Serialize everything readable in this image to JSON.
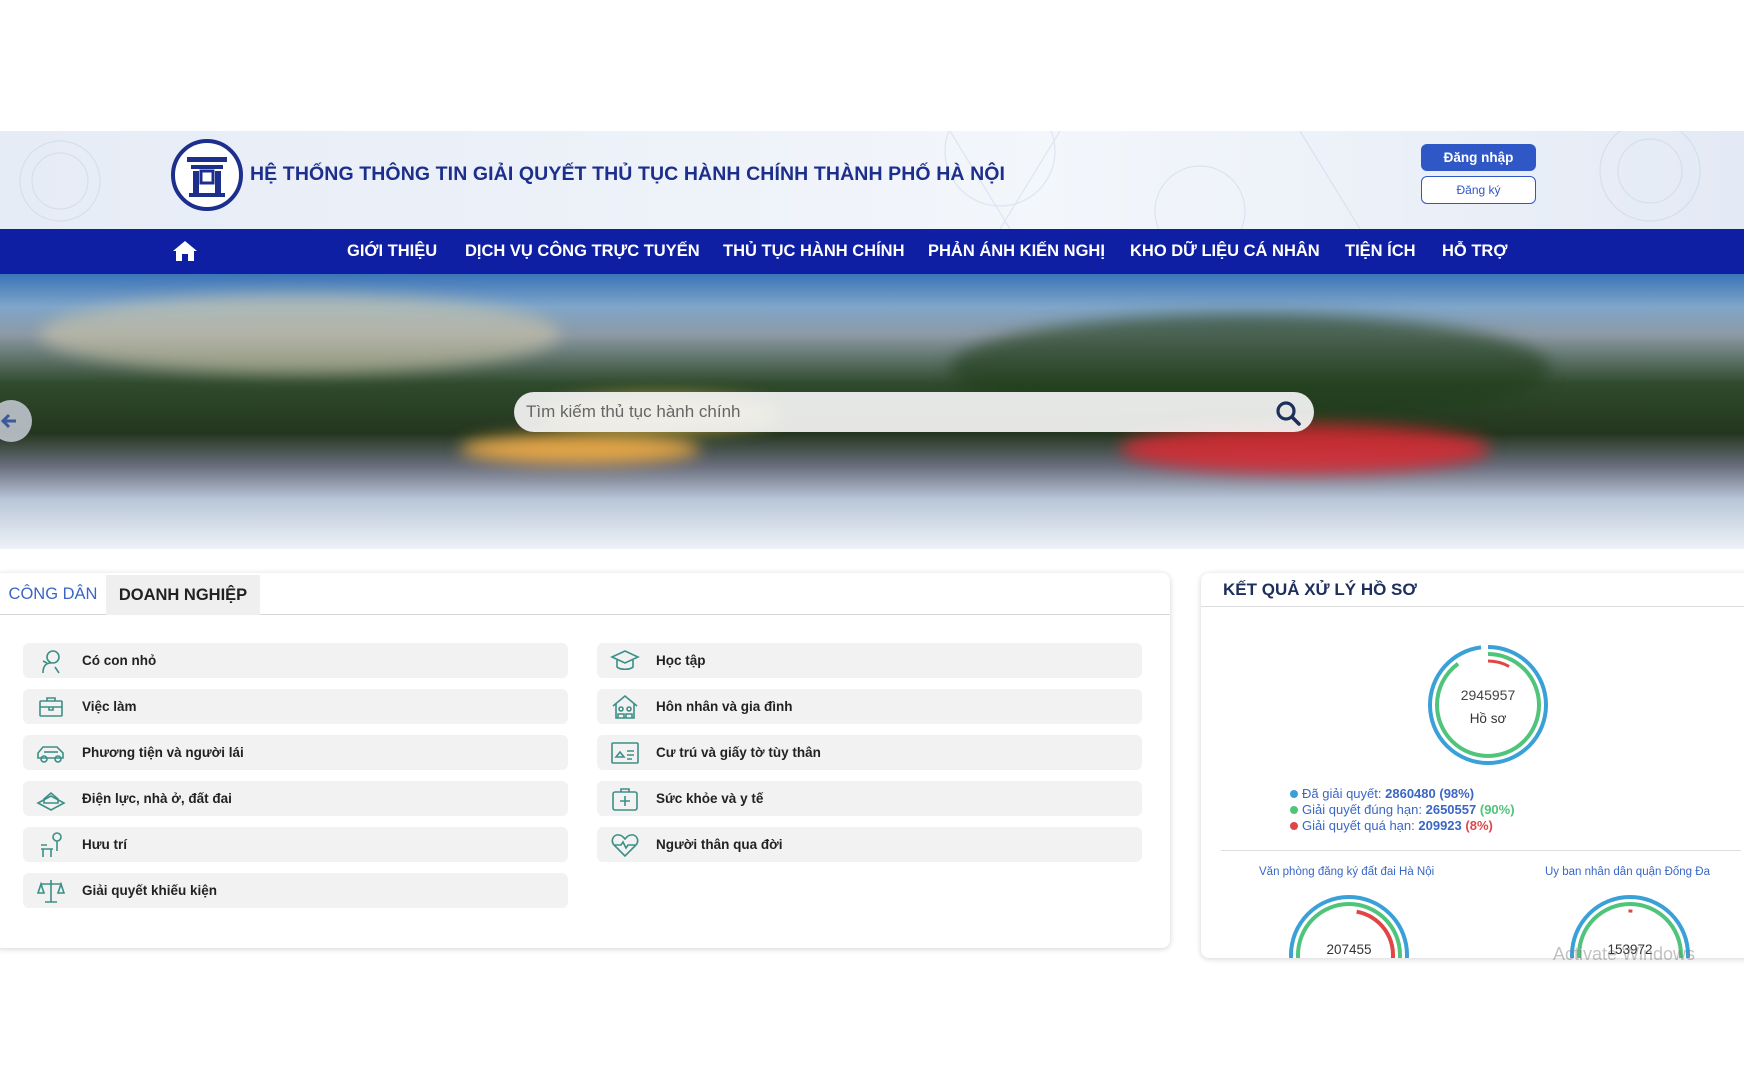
{
  "header": {
    "title": "HỆ THỐNG THÔNG TIN GIẢI QUYẾT THỦ TỤC HÀNH CHÍNH THÀNH PHỐ HÀ NỘI",
    "login_label": "Đăng nhập",
    "register_label": "Đăng ký"
  },
  "nav": {
    "home_icon": "home-icon",
    "items": [
      {
        "label": "GIỚI THIỆU"
      },
      {
        "label": "DỊCH VỤ CÔNG TRỰC TUYẾN"
      },
      {
        "label": "THỦ TỤC HÀNH CHÍNH"
      },
      {
        "label": "PHẢN ÁNH KIẾN NGHỊ"
      },
      {
        "label": "KHO DỮ LIỆU CÁ NHÂN"
      },
      {
        "label": "TIỆN ÍCH"
      },
      {
        "label": "HỖ TRỢ"
      }
    ]
  },
  "search": {
    "placeholder": "Tìm kiếm thủ tục hành chính",
    "value": ""
  },
  "tabs": {
    "citizen": "CÔNG DÂN",
    "business": "DOANH NGHIỆP"
  },
  "categories": [
    {
      "label": "Có con nhỏ",
      "icon": "baby-icon"
    },
    {
      "label": "Học tập",
      "icon": "graduation-cap-icon"
    },
    {
      "label": "Việc làm",
      "icon": "briefcase-icon"
    },
    {
      "label": "Hôn nhân và gia đình",
      "icon": "family-house-icon"
    },
    {
      "label": "Phương tiện và người lái",
      "icon": "car-icon"
    },
    {
      "label": "Cư trú và giấy tờ tùy thân",
      "icon": "id-card-icon"
    },
    {
      "label": "Điện lực, nhà ở, đất đai",
      "icon": "land-house-icon"
    },
    {
      "label": "Sức khỏe và y tế",
      "icon": "medical-kit-icon"
    },
    {
      "label": "Hưu trí",
      "icon": "retirement-bench-icon"
    },
    {
      "label": "Người thân qua đời",
      "icon": "heart-icon"
    },
    {
      "label": "Giải quyết khiếu kiện",
      "icon": "scales-icon"
    }
  ],
  "results": {
    "title": "KẾT QUẢ XỬ LÝ HỒ SƠ",
    "total": "2945957",
    "total_label": "Hồ sơ",
    "stats": [
      {
        "label": "Đã giải quyết:",
        "value": "2860480",
        "pct": "(98%)",
        "color": "#3aa0d8",
        "pct_color": "#3a66c4"
      },
      {
        "label": "Giải quyết đúng hạn:",
        "value": "2650557",
        "pct": "(90%)",
        "color": "#4fc47a",
        "pct_color": "#4fc47a"
      },
      {
        "label": "Giải quyết quá hạn:",
        "value": "209923",
        "pct": "(8%)",
        "color": "#e04646",
        "pct_color": "#e04646"
      }
    ],
    "offices": [
      {
        "name": "Văn phòng đăng ký đất đai Hà Nội",
        "total": "207455"
      },
      {
        "name": "Uy ban nhân dân quận Đống Đa",
        "total": "153972"
      }
    ]
  },
  "watermark": "Activate Windows",
  "colors": {
    "primary": "#0e1fa3",
    "accent": "#2f57c6",
    "title_blue": "#1d2f8c",
    "ring_blue": "#3aa0d8",
    "ring_green": "#4fc47a",
    "ring_red": "#e04646"
  }
}
